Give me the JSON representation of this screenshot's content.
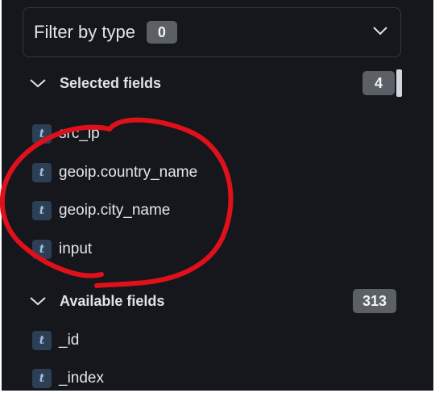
{
  "filter": {
    "label": "Filter by type",
    "count": "0",
    "chevron_icon": "chevron-down-icon"
  },
  "selected": {
    "title": "Selected fields",
    "count": "4",
    "fields": [
      {
        "type": "t",
        "name": "src_ip"
      },
      {
        "type": "t",
        "name": "geoip.country_name"
      },
      {
        "type": "t",
        "name": "geoip.city_name"
      },
      {
        "type": "t",
        "name": "input"
      }
    ]
  },
  "available": {
    "title": "Available fields",
    "count": "313",
    "fields": [
      {
        "type": "t",
        "name": "_id"
      },
      {
        "type": "t",
        "name": "_index"
      }
    ]
  },
  "colors": {
    "panel_bg": "#15171c",
    "badge_bg": "#5b5f66",
    "type_icon_bg": "#2d3f55",
    "annotation_red": "#e0101a"
  }
}
